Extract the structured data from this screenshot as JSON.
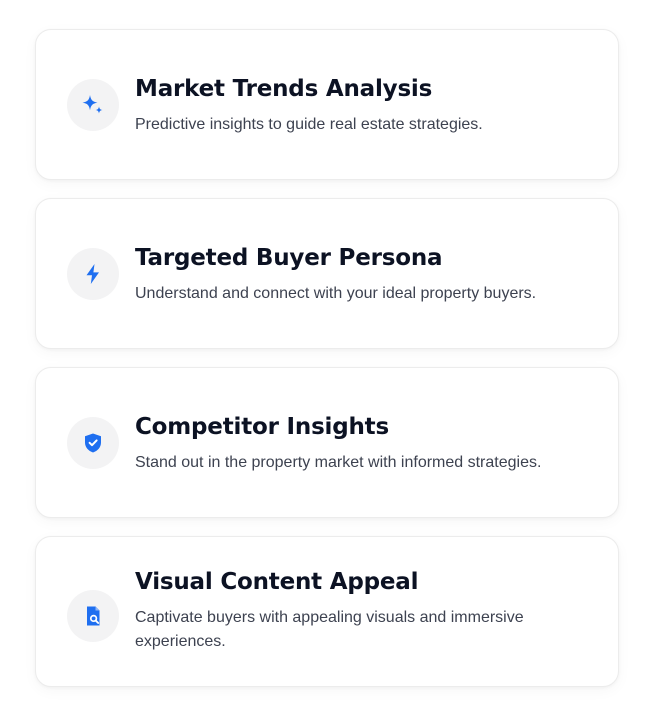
{
  "accent_color": "#1f6ff0",
  "cards": [
    {
      "icon": "sparkle-icon",
      "title": "Market Trends Analysis",
      "description": "Predictive insights to guide real estate strategies."
    },
    {
      "icon": "lightning-bolt-icon",
      "title": "Targeted Buyer Persona",
      "description": "Understand and connect with your ideal property buyers."
    },
    {
      "icon": "shield-check-icon",
      "title": "Competitor Insights",
      "description": "Stand out in the property market with informed strategies."
    },
    {
      "icon": "document-search-icon",
      "title": "Visual Content Appeal",
      "description": "Captivate buyers with appealing visuals and immersive experiences."
    }
  ]
}
